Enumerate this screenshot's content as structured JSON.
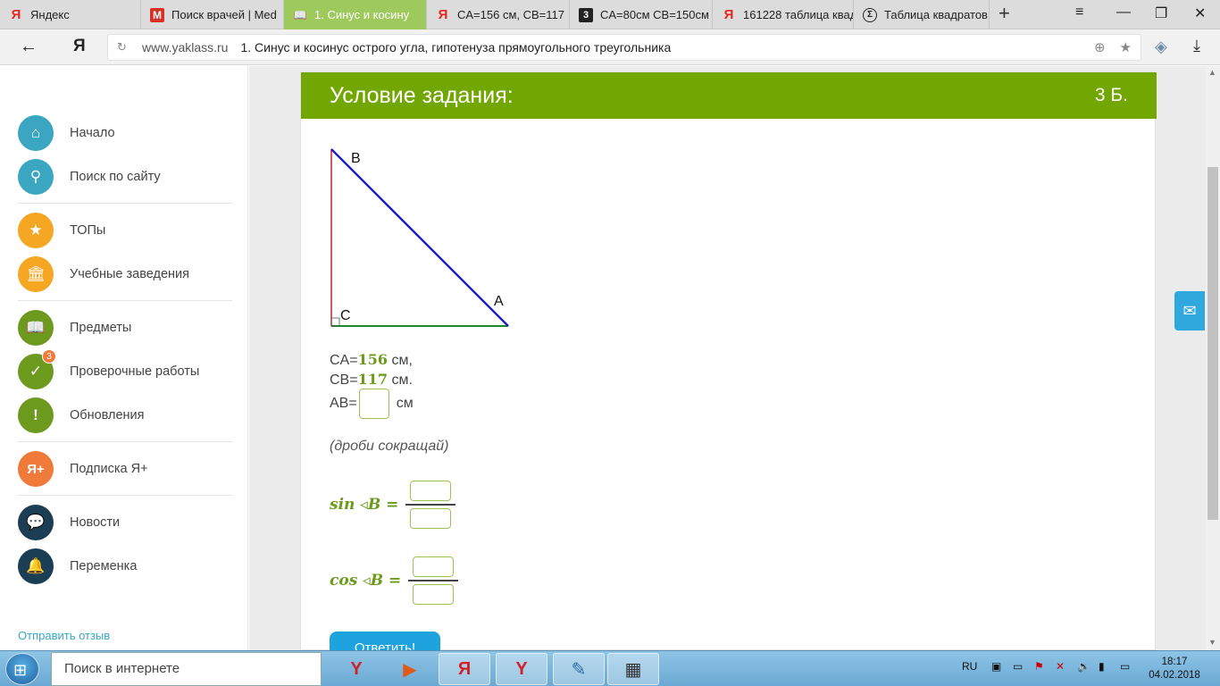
{
  "browser": {
    "tabs": [
      {
        "label": "Яндекс",
        "icon": "yandex-icon"
      },
      {
        "label": "Поиск врачей | Med",
        "icon": "gmail-icon"
      },
      {
        "label": "1. Синус и косину",
        "icon": "book-icon",
        "active": true
      },
      {
        "label": "CA=156 см, CB=117",
        "icon": "yandex-icon"
      },
      {
        "label": "CA=80см CB=150см",
        "icon": "znanija-icon"
      },
      {
        "label": "161228 таблица квад",
        "icon": "yandex-icon"
      },
      {
        "label": "Таблица квадратов",
        "icon": "sigma-icon"
      }
    ],
    "new_tab": "+",
    "window_controls": {
      "menu": "≡",
      "minimize": "—",
      "restore": "❐",
      "close": "✕"
    },
    "yandex_logo": "Я",
    "url_domain": "www.yaklass.ru",
    "page_title": "1. Синус и косинус острого угла, гипотенуза прямоугольного треугольника"
  },
  "sidebar": {
    "items": [
      {
        "label": "Начало",
        "icon": "home-icon",
        "color": "#3aa6c2"
      },
      {
        "label": "Поиск по сайту",
        "icon": "search-icon",
        "color": "#3aa6c2"
      },
      {
        "label": "ТОПы",
        "icon": "star-icon",
        "color": "#f5a623"
      },
      {
        "label": "Учебные заведения",
        "icon": "school-icon",
        "color": "#f5a623"
      },
      {
        "label": "Предметы",
        "icon": "book-icon",
        "color": "#6b9a1e"
      },
      {
        "label": "Проверочные работы",
        "icon": "check-icon",
        "color": "#6b9a1e",
        "badge": "3"
      },
      {
        "label": "Обновления",
        "icon": "exclamation-icon",
        "color": "#6b9a1e"
      },
      {
        "label": "Подписка Я+",
        "icon": "ya-plus-icon",
        "color": "#ef7a3a"
      },
      {
        "label": "Новости",
        "icon": "chat-icon",
        "color": "#1b3e55"
      },
      {
        "label": "Переменка",
        "icon": "bell-icon",
        "color": "#1b3e55"
      }
    ],
    "feedback": "Отправить отзыв"
  },
  "task": {
    "header": "Условие задания:",
    "points": "3 Б.",
    "triangle": {
      "label_b": "B",
      "label_c": "C",
      "label_a": "A"
    },
    "lines": {
      "ca_label": "CA=",
      "ca_value": "156",
      "ca_unit": "см,",
      "cb_label": "CB=",
      "cb_value": "117",
      "cb_unit": "см.",
      "ab_label": "AB=",
      "ab_unit": "см"
    },
    "hint": "(дроби сокращай)",
    "sin_label": "sin ◃B =",
    "cos_label": "cos ◃B =",
    "submit": "Ответить!"
  },
  "taskbar": {
    "search_placeholder": "Поиск в интернете",
    "lang": "RU",
    "time": "18:17",
    "date": "04.02.2018"
  }
}
